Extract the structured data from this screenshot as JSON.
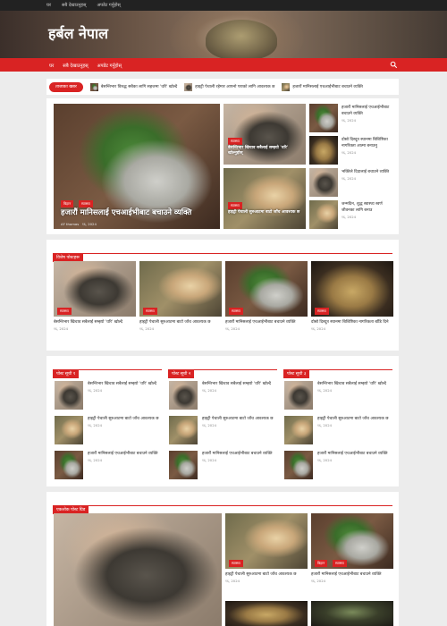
{
  "topbar": {
    "links": [
      "घर",
      "सबै देखाउनुहस्",
      "अपडेट गर्नुहोस्"
    ]
  },
  "site": {
    "title": "हर्बल नेपाल"
  },
  "nav": {
    "items": [
      "घर",
      "सबै देखाउनुहस्",
      "अपडेट गर्नुहोस्"
    ],
    "search_icon": "search-icon"
  },
  "ticker": {
    "label": "ताजाका खबर",
    "items": [
      "बेसन्तिभार विरुद्ध सबैका लागि सहजमा 'धरि' खोल्दै",
      "हाइट्री पेचाली रहेमार आफ्नो पराको लागि आवश्यक छ",
      "हजारौं मानिसलाई एचआईभीबाट बचाउने व्यक्ति"
    ]
  },
  "featured": {
    "main": {
      "category": "बिहान",
      "category2": "स्वास्थ्य",
      "title": "हजारौं मानिसलाई एचआईभीबाट बचाउने व्यक्ति",
      "author": "AF thomas",
      "date": "१६, 2024"
    },
    "mid_top": {
      "category": "स्वास्थ्य",
      "title": "बेसन्तिभार खिचाव सबैलाई सम्झ्यो 'धरि' खोल्नुहोस्"
    },
    "mid_bottom": {
      "category": "स्वास्थ्य",
      "title": "हाइट्री पेचाली सुरुआटमा बाटो जाँच आवश्यक छ"
    },
    "side": [
      {
        "title": "हजारौं मानिसलाई एचआईभीबाट बचाउने व्यक्ति",
        "date": "१६, 2024"
      },
      {
        "title": "दोस्रो दिस्दूत्र स्थानमा बिशिष्टिका नागरिक्ता आत्मा बनाउनु",
        "date": "१६, 2024"
      },
      {
        "title": "भक्तिले दिदालाई बचाउने व्यक्ति",
        "date": "१६, 2024"
      },
      {
        "title": "जन्मदिन, शुद्ध स्वास्थ्य स्वर्ण जीवनका लागि बनाउ",
        "date": "१६, 2024"
      }
    ]
  },
  "special": {
    "heading": "विशेष पोस्टहरू",
    "cards": [
      {
        "category": "स्वास्थ्य",
        "title": "बेसन्तिभार खिचाव सबैलाई सम्झ्यो 'धरि' खोल्दै",
        "date": "१६, 2024"
      },
      {
        "category": "स्वास्थ्य",
        "title": "हाइट्री पेचाली सुरुआटमा बाटो जाँच आवश्यक छ",
        "date": "१६, 2024"
      },
      {
        "category": "स्वास्थ्य",
        "title": "हजारौं मानिसलाई एचआईभीबाट बचाउने व्यक्ति",
        "date": "१६, 2024"
      },
      {
        "category": "स्वास्थ्य",
        "title": "दोस्रो दिस्दूत्र स्थानमा बिशिष्टिका नागरिकता बाँडि दिने",
        "date": "१६, 2024"
      }
    ]
  },
  "lists": [
    {
      "heading": "पोस्ट सूची १",
      "items": [
        {
          "title": "बेसन्तिभार खिचाव सबैलाई सम्झ्यो 'धरि' खोल्दै",
          "date": "१६, 2024"
        },
        {
          "title": "हाइट्री पेचाली सुरुआटमा बाटो जाँच आवश्यक छ",
          "date": "१६, 2024"
        },
        {
          "title": "हजारौं मानिसलाई एचआईभीबाट बचाउने व्यक्ति",
          "date": "१६, 2024"
        }
      ]
    },
    {
      "heading": "पोस्ट सूची २",
      "items": [
        {
          "title": "बेसन्तिभार खिचाव सबैलाई सम्झ्यो 'धरि' खोल्दै",
          "date": "१६, 2024"
        },
        {
          "title": "हाइट्री पेचाली सुरुआटमा बाटो जाँच आवश्यक छ",
          "date": "१६, 2024"
        },
        {
          "title": "हजारौं मानिसलाई एचआईभीबाट बचाउने व्यक्ति",
          "date": "१६, 2024"
        }
      ]
    },
    {
      "heading": "पोस्ट सूची ३",
      "items": [
        {
          "title": "बेसन्तिभार खिचाव सबैलाई सम्झ्यो 'धरि' खोल्दै",
          "date": "१६, 2024"
        },
        {
          "title": "हाइट्री पेचाली सुरुआटमा बाटो जाँच आवश्यक छ",
          "date": "१६, 2024"
        },
        {
          "title": "हजारौं मानिसलाई एचआईभीबाट बचाउने व्यक्ति",
          "date": "१६, 2024"
        }
      ]
    }
  ],
  "single": {
    "heading": "एकलोक पोस्ट ग्रिड",
    "cards": [
      {
        "category": "स्वास्थ्य",
        "title": "हाइट्री पेचाली सुरुआटमा बाटो जाँच आवश्यक छ",
        "date": "१६, 2024"
      },
      {
        "category": "बिहान",
        "category2": "स्वास्थ्य",
        "title": "हजारौं मानिसलाई एचआईभीबाट बचाउने व्यक्ति",
        "date": "१६, 2024"
      }
    ]
  }
}
